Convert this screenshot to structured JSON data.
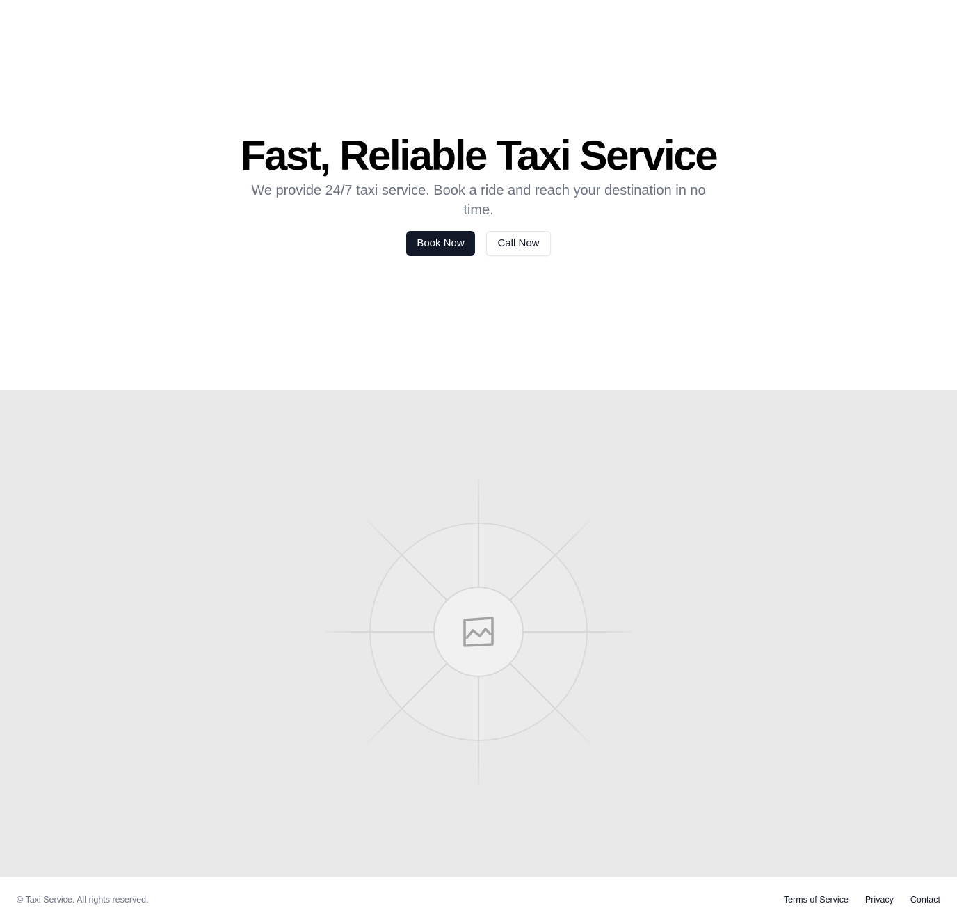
{
  "hero": {
    "title": "Fast, Reliable Taxi Service",
    "subtitle": "We provide 24/7 taxi service. Book a ride and reach your destination in no time.",
    "primary_button": "Book Now",
    "secondary_button": "Call Now"
  },
  "image_placeholder": {
    "icon": "image-icon",
    "background_color": "#e9e9e9"
  },
  "footer": {
    "copyright": "© Taxi Service. All rights reserved.",
    "links": [
      "Terms of Service",
      "Privacy",
      "Contact"
    ]
  },
  "colors": {
    "primary_button_bg": "#111827",
    "subtitle_text": "#6b7280"
  }
}
